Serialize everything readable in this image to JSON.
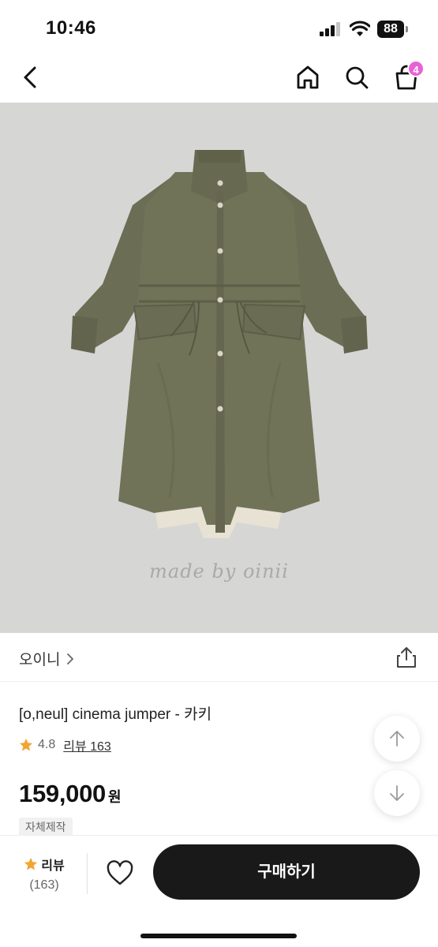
{
  "status_bar": {
    "time": "10:46",
    "battery": "88"
  },
  "nav": {
    "cart_badge": "4"
  },
  "hero": {
    "watermark": "made by oinii"
  },
  "brand": {
    "name": "오이니"
  },
  "product": {
    "title": "[o,neul] cinema jumper - 카키",
    "rating": "4.8",
    "review_link": "리뷰 163",
    "price": "159,000",
    "price_unit": "원",
    "tag": "자체제작"
  },
  "bottom_bar": {
    "review_label": "리뷰",
    "review_count": "(163)",
    "buy_label": "구매하기"
  },
  "colors": {
    "star": "#f2a531",
    "cart_badge": "#e862d5",
    "buy_button": "#191919",
    "coat": "#6f7158",
    "hero_background": "#d6d6d4"
  },
  "icons": [
    "back-icon",
    "home-icon",
    "search-icon",
    "cart-icon",
    "share-icon",
    "chevron-right-icon",
    "star-icon",
    "arrow-up-icon",
    "arrow-down-icon",
    "heart-icon"
  ]
}
